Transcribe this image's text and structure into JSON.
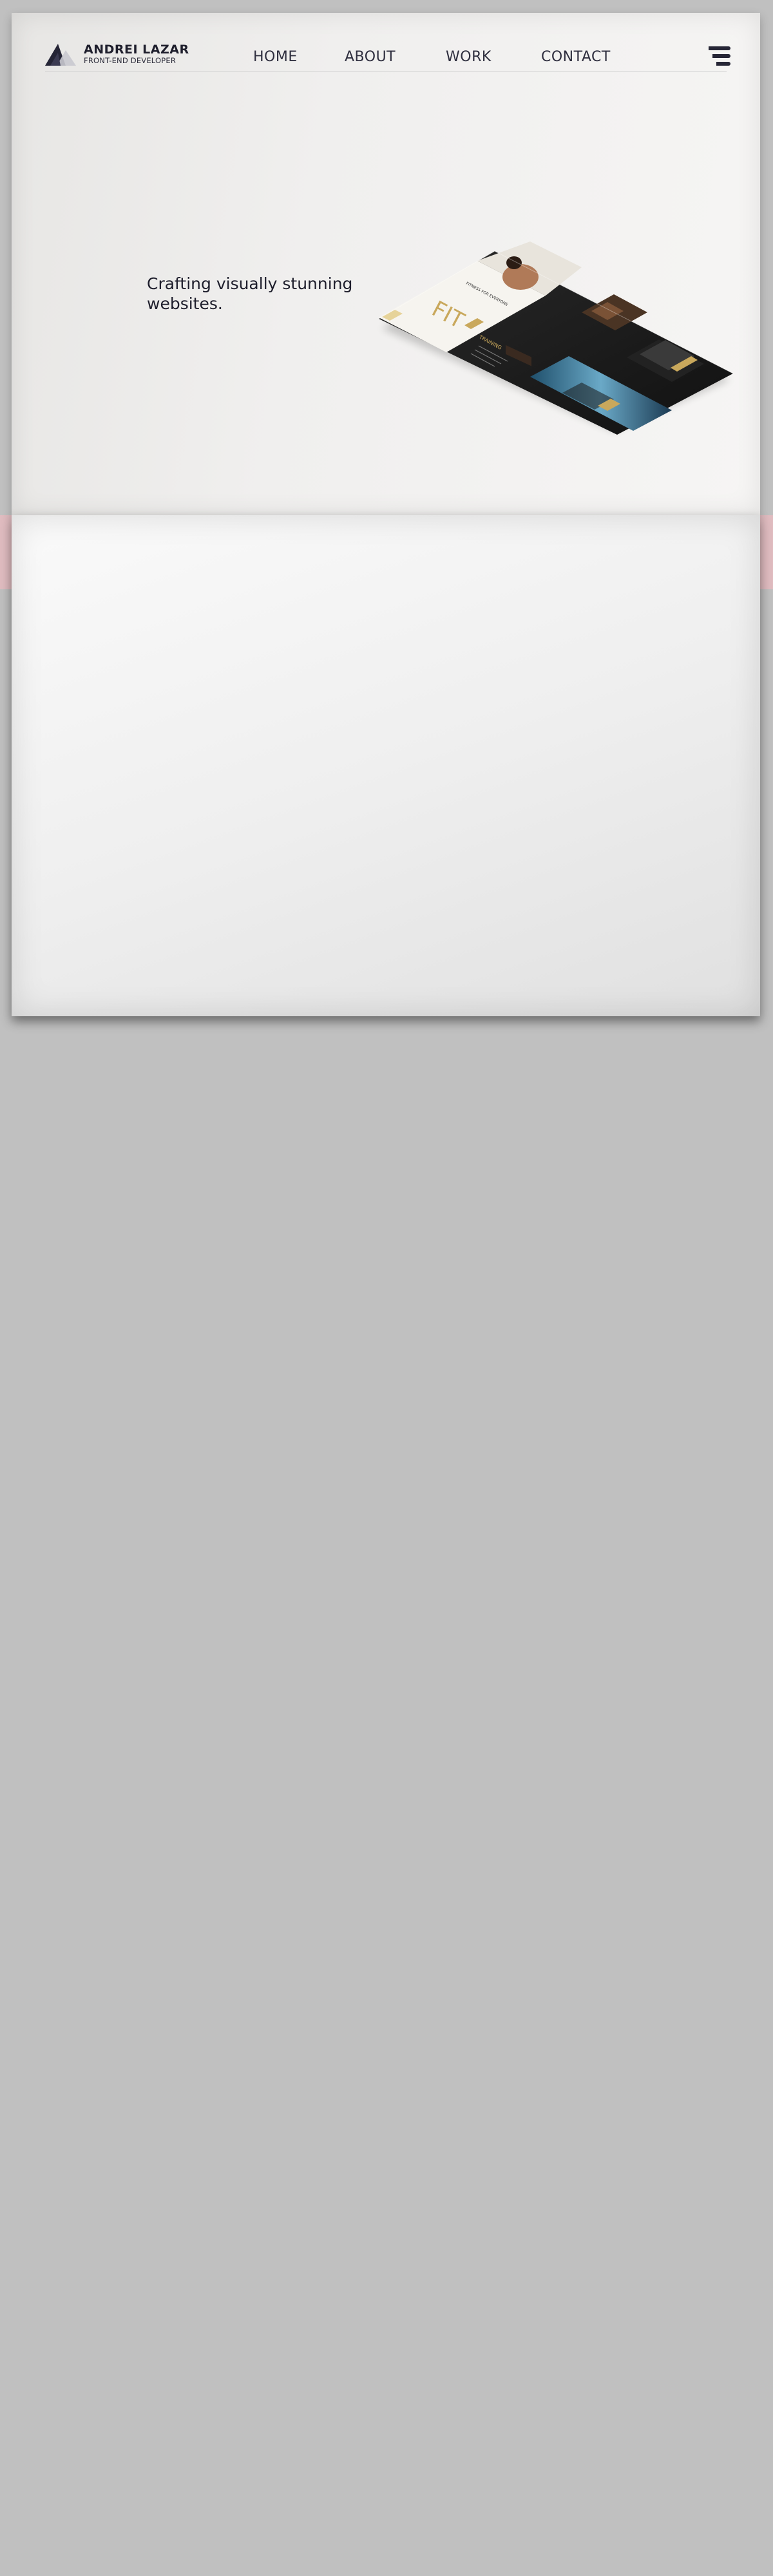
{
  "brand": {
    "name": "ANDREI LAZAR",
    "subtitle": "FRONT-END DEVELOPER",
    "logo_icon": "triangle-logo-icon"
  },
  "nav": {
    "items": [
      {
        "label": "HOME"
      },
      {
        "label": "ABOUT"
      },
      {
        "label": "WORK"
      },
      {
        "label": "CONTACT"
      }
    ],
    "menu_icon": "hamburger-menu-icon"
  },
  "hero": {
    "tagline": "Crafting visually stunning websites.",
    "mockup": {
      "heading": "FIT",
      "banner_text": "FITNESS FOR EVERYONE",
      "section_title": "TRAINING"
    }
  },
  "colors": {
    "page_background": "#c0c0c0",
    "band": "#e0bcc0",
    "text_dark": "#1e1e2c",
    "mockup_accent": "#c9a85c"
  }
}
